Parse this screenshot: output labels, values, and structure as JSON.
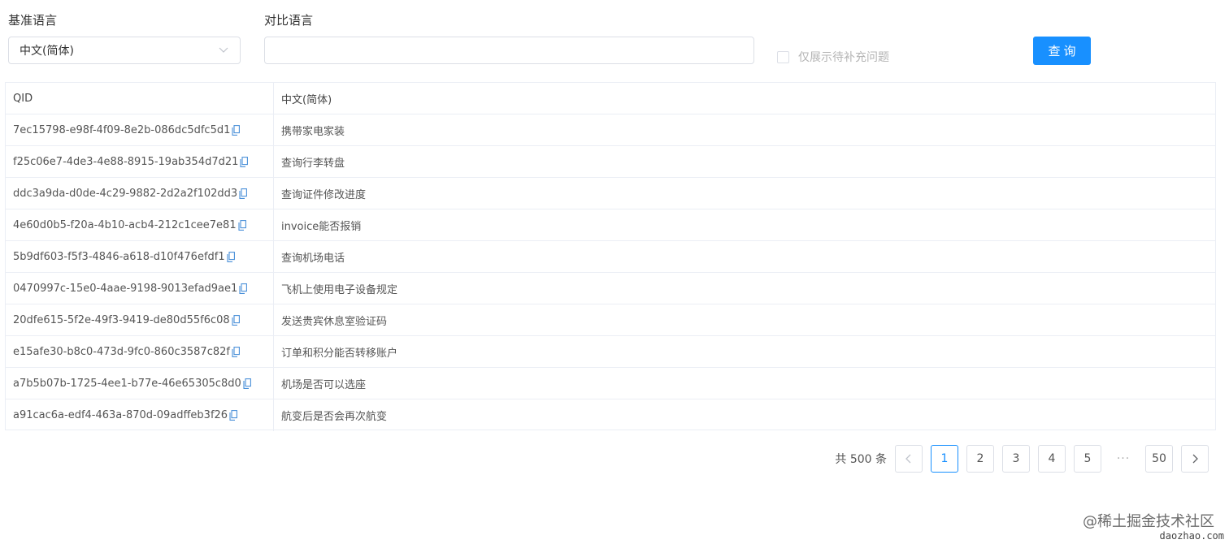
{
  "filters": {
    "base_language_label": "基准语言",
    "base_language_value": "中文(简体)",
    "compare_language_label": "对比语言",
    "compare_language_value": "",
    "compare_language_placeholder": "",
    "checkbox_label": "仅展示待补充问题",
    "checkbox_checked": false,
    "query_button_label": "查询",
    "accent_color": "#1890ff"
  },
  "table": {
    "headers": [
      "QID",
      "中文(简体)"
    ],
    "rows": [
      {
        "qid": "7ec15798-e98f-4f09-8e2b-086dc5dfc5d1",
        "text": "携带家电家装"
      },
      {
        "qid": "f25c06e7-4de3-4e88-8915-19ab354d7d21",
        "text": "查询行李转盘"
      },
      {
        "qid": "ddc3a9da-d0de-4c29-9882-2d2a2f102dd3",
        "text": "查询证件修改进度"
      },
      {
        "qid": "4e60d0b5-f20a-4b10-acb4-212c1cee7e81",
        "text": "invoice能否报销"
      },
      {
        "qid": "5b9df603-f5f3-4846-a618-d10f476efdf1",
        "text": "查询机场电话"
      },
      {
        "qid": "0470997c-15e0-4aae-9198-9013efad9ae1",
        "text": "飞机上使用电子设备规定"
      },
      {
        "qid": "20dfe615-5f2e-49f3-9419-de80d55f6c08",
        "text": "发送贵宾休息室验证码"
      },
      {
        "qid": "e15afe30-b8c0-473d-9fc0-860c3587c82f",
        "text": "订单和积分能否转移账户"
      },
      {
        "qid": "a7b5b07b-1725-4ee1-b77e-46e65305c8d0",
        "text": "机场是否可以选座"
      },
      {
        "qid": "a91cac6a-edf4-463a-870d-09adffeb3f26",
        "text": "航变后是否会再次航变"
      }
    ]
  },
  "pagination": {
    "total_text": "共 500 条",
    "prev_icon": "chevron-left-icon",
    "next_icon": "chevron-right-icon",
    "pages": [
      "1",
      "2",
      "3",
      "4",
      "5"
    ],
    "current_page": "1",
    "ellipsis": "···",
    "last_page": "50"
  },
  "watermark": {
    "line1": "@稀土掘金技术社区",
    "line2": "daozhao.com"
  },
  "icons": {
    "select_arrow": "chevron-down-icon",
    "copy": "copy-icon"
  }
}
